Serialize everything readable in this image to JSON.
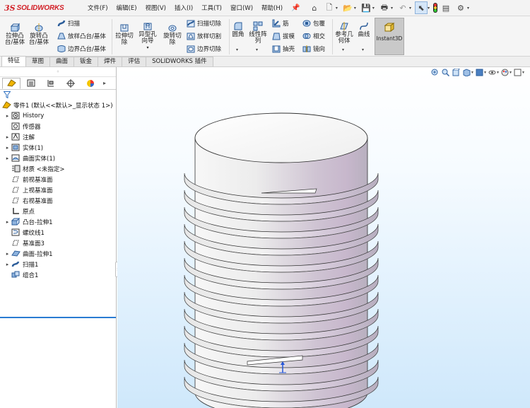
{
  "app": {
    "logo_ds": "3S",
    "logo_text": "SOLIDWORKS"
  },
  "menu": [
    "文件(F)",
    "编辑(E)",
    "视图(V)",
    "插入(I)",
    "工具(T)",
    "窗口(W)",
    "帮助(H)"
  ],
  "ribbon": {
    "extrude_boss": "拉伸凸台/基体",
    "revolve_boss": "旋转凸台/基体",
    "sweep": "扫描",
    "loft_boss": "放样凸台/基体",
    "boundary_boss": "边界凸台/基体",
    "extrude_cut": "拉伸切除",
    "hole_wizard": "异型孔向导",
    "revolve_cut": "旋转切除",
    "swept_cut": "扫描切除",
    "lofted_cut": "放样切割",
    "boundary_cut": "边界切除",
    "fillet": "圆角",
    "linear_pattern": "线性阵列",
    "rib": "筋",
    "draft": "拔模",
    "shell": "抽壳",
    "wrap": "包覆",
    "intersect": "相交",
    "mirror": "镜向",
    "ref_geometry": "参考几何体",
    "curves": "曲线",
    "instant3d": "Instant3D"
  },
  "tabs": [
    {
      "label": "特征",
      "active": true
    },
    {
      "label": "草图",
      "active": false
    },
    {
      "label": "曲面",
      "active": false
    },
    {
      "label": "钣金",
      "active": false
    },
    {
      "label": "焊件",
      "active": false
    },
    {
      "label": "评估",
      "active": false
    },
    {
      "label": "SOLIDWORKS 插件",
      "active": false
    }
  ],
  "tree": {
    "root": "零件1 (默认<<默认>_显示状态 1>)",
    "items": [
      {
        "label": "History",
        "icon": "history-folder-icon",
        "expandable": true
      },
      {
        "label": "传感器",
        "icon": "sensor-icon",
        "expandable": false
      },
      {
        "label": "注解",
        "icon": "annotations-icon",
        "expandable": true
      },
      {
        "label": "实体(1)",
        "icon": "solid-bodies-icon",
        "expandable": true
      },
      {
        "label": "曲面实体(1)",
        "icon": "surface-bodies-icon",
        "expandable": true
      },
      {
        "label": "材质 <未指定>",
        "icon": "material-icon",
        "expandable": false
      },
      {
        "label": "前视基准面",
        "icon": "plane-icon",
        "expandable": false
      },
      {
        "label": "上视基准面",
        "icon": "plane-icon",
        "expandable": false
      },
      {
        "label": "右视基准面",
        "icon": "plane-icon",
        "expandable": false
      },
      {
        "label": "原点",
        "icon": "origin-icon",
        "expandable": false
      },
      {
        "label": "凸台-拉伸1",
        "icon": "boss-extrude-icon",
        "expandable": true
      },
      {
        "label": "螺纹线1",
        "icon": "helix-icon",
        "expandable": false
      },
      {
        "label": "基准面3",
        "icon": "plane-icon",
        "expandable": false
      },
      {
        "label": "曲面-拉伸1",
        "icon": "surface-extrude-icon",
        "expandable": true
      },
      {
        "label": "扫描1",
        "icon": "sweep-icon",
        "expandable": true
      },
      {
        "label": "组合1",
        "icon": "combine-icon",
        "expandable": false
      }
    ]
  },
  "colors": {
    "accent": "#2a7bd2",
    "brand": "#d21f26",
    "viewport_bottom": "#cfe8fb"
  }
}
